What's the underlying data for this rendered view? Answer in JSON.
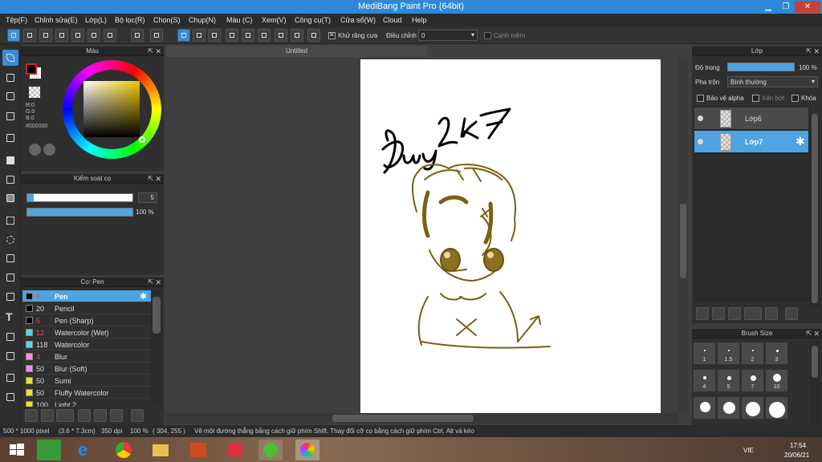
{
  "window": {
    "title": "MediBang Paint Pro (64bit)"
  },
  "menu": [
    "Tệp(F)",
    "Chỉnh sửa(E)",
    "Lớp(L)",
    "Bộ lọc(R)",
    "Chọn(S)",
    "Chụp(N)",
    "Màu (C)",
    "Xem(V)",
    "Công cụ(T)",
    "Cửa sổ(W)",
    "Cloud",
    "Help"
  ],
  "toolbar": {
    "antialias_label": "Khử răng cưa",
    "adjust_label": "Điều chỉnh",
    "adjust_value": "0",
    "edge_label": "Cạnh mềm"
  },
  "color_panel": {
    "title": "Màu",
    "r": "R:0",
    "g": "G:0",
    "b": "B:0",
    "hex": "#000000",
    "fg": "#000000",
    "bg": "#ffffff"
  },
  "brush_control": {
    "title": "Kiểm soát cọ",
    "size_value": "5",
    "opacity_value": "100 %",
    "size_fraction": 0.06,
    "opacity_fraction": 1.0
  },
  "brush_panel": {
    "title": "Cọ: Pen",
    "items": [
      {
        "size": "5",
        "name": "Pen",
        "color": "#000000",
        "size_color": "#e05050"
      },
      {
        "size": "20",
        "name": "Pencil",
        "color": "#000000",
        "size_color": "#dddddd"
      },
      {
        "size": "5",
        "name": "Pen (Sharp)",
        "color": "#000000",
        "size_color": "#e05050"
      },
      {
        "size": "12",
        "name": "Watercolor (Wet)",
        "color": "#5fd0f0",
        "size_color": "#e05050"
      },
      {
        "size": "118",
        "name": "Watercolor",
        "color": "#5fd0f0",
        "size_color": "#dddddd"
      },
      {
        "size": "4",
        "name": "Blur",
        "color": "#f08ce8",
        "size_color": "#e05050"
      },
      {
        "size": "50",
        "name": "Blur (Soft)",
        "color": "#f08ce8",
        "size_color": "#dddddd"
      },
      {
        "size": "50",
        "name": "Sumi",
        "color": "#e8e820",
        "size_color": "#dddddd"
      },
      {
        "size": "50",
        "name": "Fluffy Watercolor",
        "color": "#e8e820",
        "size_color": "#dddddd"
      },
      {
        "size": "100",
        "name": "Light 2",
        "color": "#e8e820",
        "size_color": "#dddddd"
      }
    ]
  },
  "canvas": {
    "tab_title": "Untitled",
    "signature": "Duy2K7"
  },
  "layer_panel": {
    "title": "Lớp",
    "opacity_label": "Độ trong",
    "opacity_value": "100 %",
    "blend_label": "Pha trộn",
    "blend_value": "Bình thường",
    "protect_alpha": "Bảo vệ alpha",
    "clip": "Xén bớt",
    "lock": "Khóa",
    "layers": [
      {
        "name": "Lớp6",
        "selected": false
      },
      {
        "name": "Lớp7",
        "selected": true
      }
    ]
  },
  "brush_size_panel": {
    "title": "Brush Size",
    "sizes": [
      "1",
      "1.5",
      "2",
      "3",
      "4",
      "5",
      "7",
      "10",
      "",
      "",
      "",
      ""
    ]
  },
  "status": {
    "dimensions": "500 * 1000 pixel",
    "cm": "(3.6 * 7.3cm)",
    "dpi": "350 dpi",
    "zoom": "100 %",
    "coords": "( 304, 255 )",
    "hint": "Vẽ một đường thẳng bằng cách giữ phím Shift, Thay đổi cỡ cọ bằng cách giữ phím Ctrl, Alt và kéo"
  },
  "taskbar": {
    "lang": "VIE",
    "time": "17:54",
    "date": "20/06/21"
  },
  "colors": {
    "accent": "#3a8bd6",
    "titlebar": "#2d89d8",
    "sketch": "#7a6010"
  }
}
